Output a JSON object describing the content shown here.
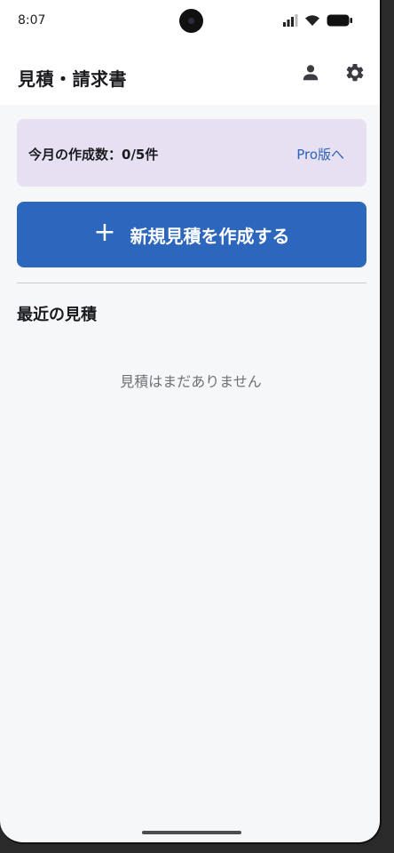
{
  "status_bar": {
    "time": "8:07",
    "icons": [
      "signal-icon",
      "wifi-icon",
      "battery-icon"
    ]
  },
  "app_bar": {
    "title": "見積・請求書",
    "actions": [
      "account-icon",
      "settings-gear-icon"
    ]
  },
  "usage_card": {
    "usage_text": "今月の作成数：0/5件",
    "pro_link": "Pro版へ"
  },
  "create_button": {
    "icon": "+",
    "label": "新規見積を作成する"
  },
  "recent": {
    "title": "最近の見積",
    "empty_message": "見積はまだありません"
  },
  "colors": {
    "primary": "#2d66bd",
    "card_background": "#e7e0f3",
    "link": "#2b63b8",
    "page_background": "#f6f7f9"
  }
}
